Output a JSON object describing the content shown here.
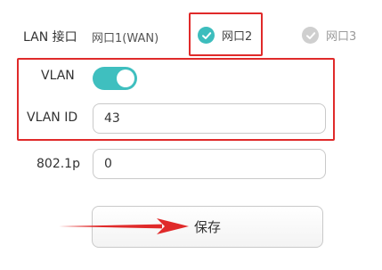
{
  "lan_port": {
    "label": "LAN 接口",
    "options": [
      {
        "label": "网口1(WAN)",
        "state": "unchecked"
      },
      {
        "label": "网口2",
        "state": "selected"
      },
      {
        "label": "网口3",
        "state": "disabled"
      }
    ]
  },
  "vlan": {
    "label": "VLAN",
    "enabled": true,
    "id_label": "VLAN ID",
    "id_value": "43"
  },
  "dot1p": {
    "label": "802.1p",
    "value": "0"
  },
  "save": {
    "label": "保存"
  },
  "colors": {
    "accent": "#3fbfbf",
    "highlight": "#e02a2a",
    "disabled": "#cfcfcf"
  }
}
